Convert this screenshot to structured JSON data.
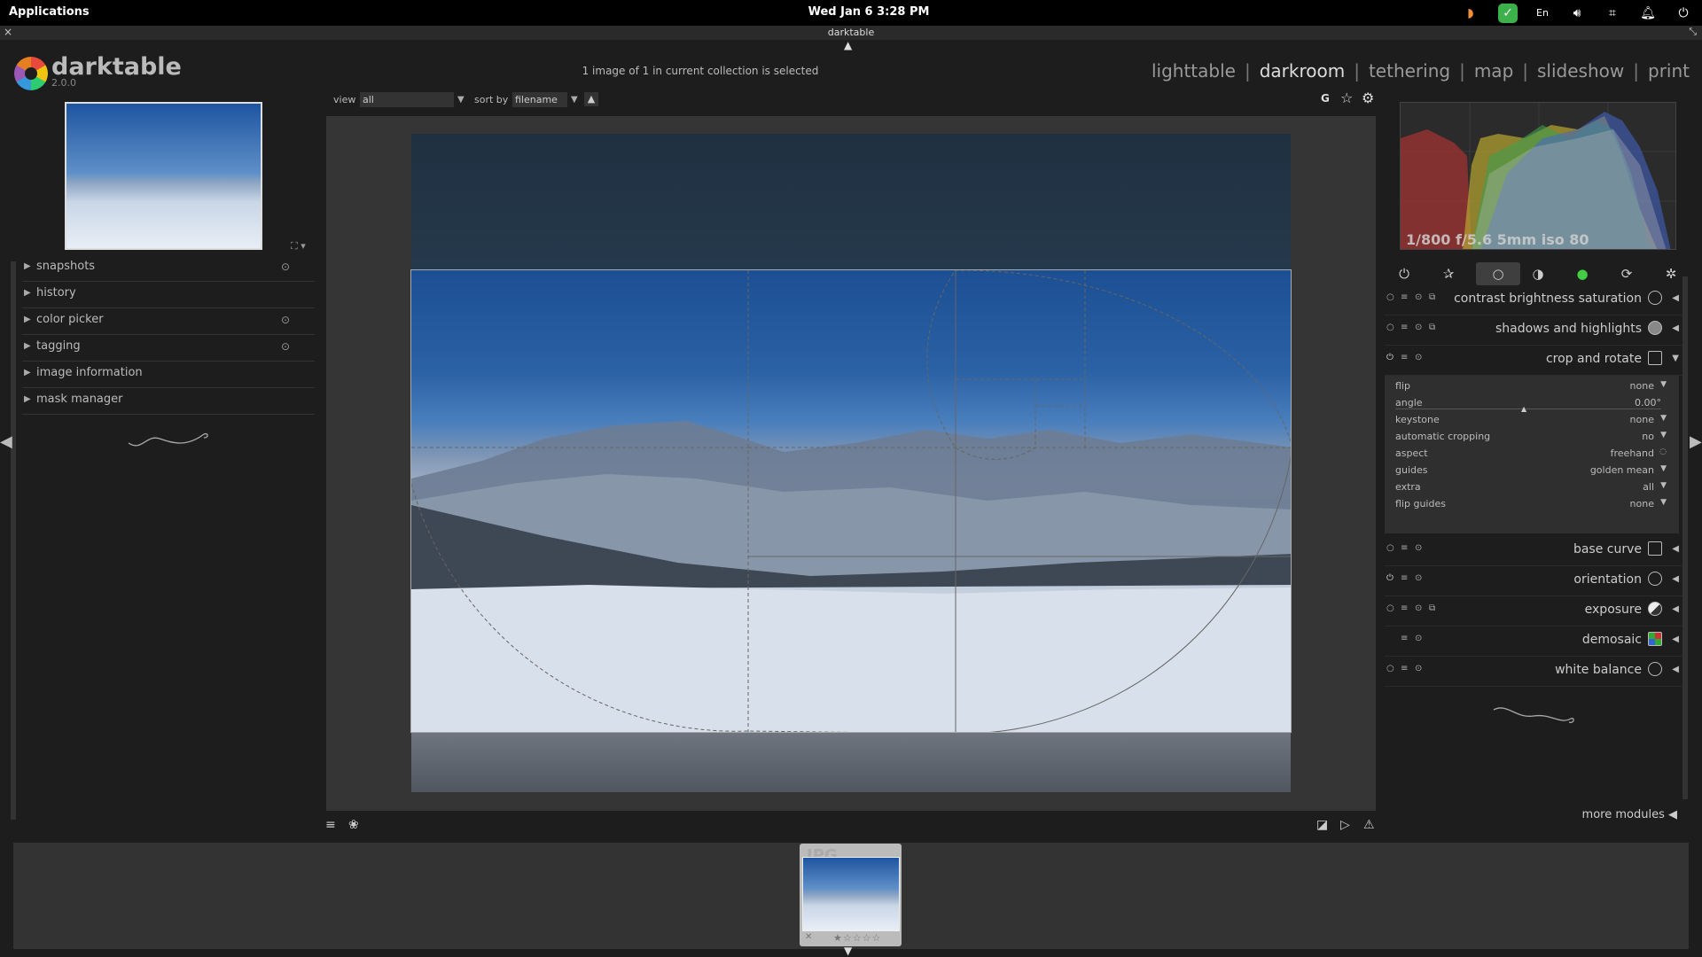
{
  "system": {
    "apps_label": "Applications",
    "clock": "Wed Jan  6    3:28 PM",
    "tray_icons": [
      "night-light-icon",
      "shield-check-icon",
      "keyboard-layout-icon",
      "volume-icon",
      "network-icon",
      "notifications-icon",
      "power-icon"
    ],
    "keyboard_layout": "En"
  },
  "window": {
    "title": "darktable",
    "close_glyph": "×",
    "fullscreen_glyph": "⤡"
  },
  "header": {
    "app_name": "darktable",
    "version": "2.0.0",
    "collection_info": "1 image of 1 in current collection is selected",
    "views": [
      "lighttable",
      "darkroom",
      "tethering",
      "map",
      "slideshow",
      "print"
    ],
    "active_view": "darkroom"
  },
  "left_panel": {
    "modules": [
      {
        "label": "snapshots",
        "has_icon": true
      },
      {
        "label": "history",
        "has_icon": false
      },
      {
        "label": "color picker",
        "has_icon": true
      },
      {
        "label": "tagging",
        "has_icon": true
      },
      {
        "label": "image information",
        "has_icon": false
      },
      {
        "label": "mask manager",
        "has_icon": false
      }
    ]
  },
  "toolbar": {
    "view_label": "view",
    "view_value": "all",
    "sort_label": "sort by",
    "sort_value": "filename",
    "sort_order_glyph": "▲",
    "grouping_glyph": "G",
    "star_glyph": "☆",
    "gear_glyph": "⚙"
  },
  "histogram": {
    "exif": "1/800 f/5.6 5mm iso 80"
  },
  "module_groups": [
    "power-icon",
    "favorites-icon",
    "basic-group-icon",
    "tone-group-icon",
    "color-group-icon",
    "correct-group-icon",
    "effect-group-icon"
  ],
  "right_modules": [
    {
      "name": "contrast brightness saturation",
      "expanded": false
    },
    {
      "name": "shadows and highlights",
      "expanded": false
    },
    {
      "name": "crop and rotate",
      "expanded": true
    },
    {
      "name": "base curve",
      "expanded": false
    },
    {
      "name": "orientation",
      "expanded": false
    },
    {
      "name": "exposure",
      "expanded": false
    },
    {
      "name": "demosaic",
      "expanded": false
    },
    {
      "name": "white balance",
      "expanded": false
    }
  ],
  "crop_params": [
    {
      "label": "flip",
      "value": "none"
    },
    {
      "label": "angle",
      "value": "0.00°"
    },
    {
      "label": "keystone",
      "value": "none"
    },
    {
      "label": "automatic cropping",
      "value": "no"
    },
    {
      "label": "aspect",
      "value": "freehand"
    },
    {
      "label": "guides",
      "value": "golden mean"
    },
    {
      "label": "extra",
      "value": "all"
    },
    {
      "label": "flip guides",
      "value": "none"
    }
  ],
  "more_modules": "more modules",
  "filmstrip": {
    "ext_label": "JPG",
    "stars": "★☆☆☆☆"
  }
}
